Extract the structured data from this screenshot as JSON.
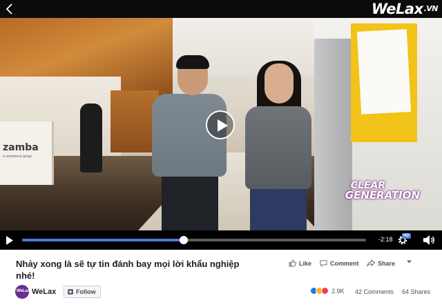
{
  "video": {
    "brand_main": "WeLax",
    "brand_suffix": ".VN",
    "desk_logo": "zamba",
    "desk_sub": "e-commerce group",
    "overlay_line1": "CLEAR",
    "overlay_line2": "GENERATION",
    "time_remaining": "-2:18",
    "quality_badge": "HD",
    "progress_fraction": 0.47
  },
  "post": {
    "title": "Nhảy xong là sẽ tự tin đánh bay mọi lời khẩu nghiệp nhé!",
    "actions": {
      "like": "Like",
      "comment": "Comment",
      "share": "Share"
    },
    "page_name": "WeLax",
    "avatar_text": "WeLax",
    "follow_label": "Follow",
    "reaction_count": "2.9K",
    "comments_count": "42 Comments",
    "shares_count": "64 Shares"
  },
  "colors": {
    "progress": "#4a7bd9",
    "avatar": "#6b2c8f",
    "like_reaction": "#1877f2",
    "haha_reaction": "#f7b125",
    "love_reaction": "#f33e58"
  },
  "icons": [
    "back-icon",
    "play-icon",
    "settings-gear-icon",
    "volume-icon",
    "like-thumb-icon",
    "comment-bubble-icon",
    "share-arrow-icon",
    "more-caret-icon",
    "follow-icon"
  ]
}
